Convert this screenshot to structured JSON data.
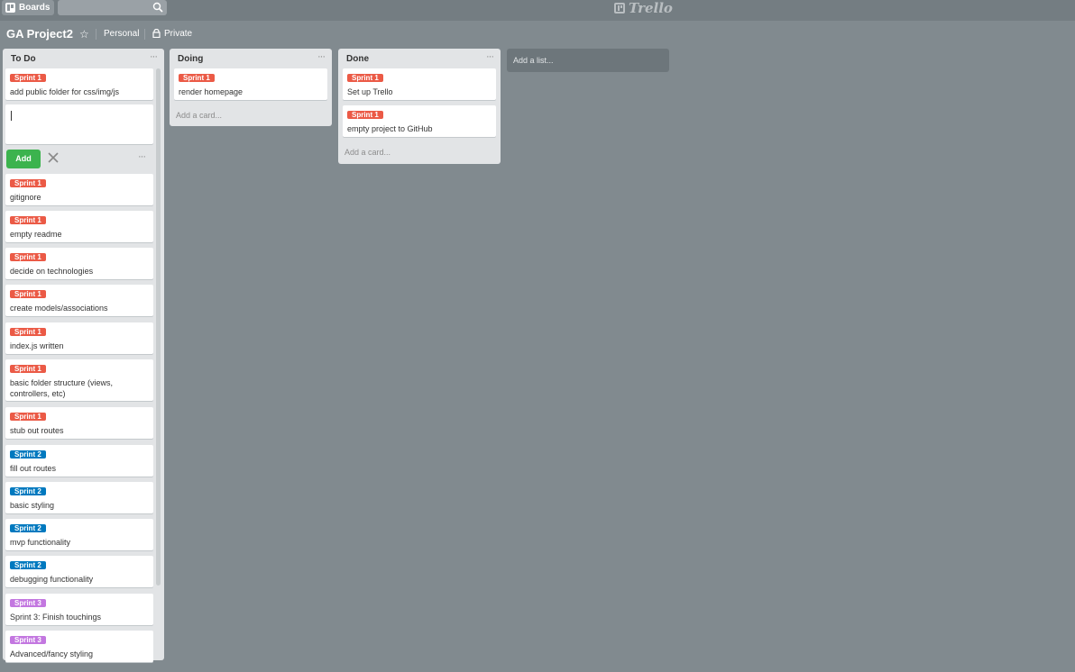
{
  "header": {
    "boards_label": "Boards",
    "search_placeholder": "",
    "logo_text": "Trello"
  },
  "board": {
    "title": "GA Project2",
    "team": "Personal",
    "privacy": "Private"
  },
  "lists": [
    {
      "title": "To Do",
      "cards_before_composer": [
        {
          "label": "Sprint 1",
          "label_color": "#eb5a46",
          "title": "add public folder for css/img/js"
        }
      ],
      "composer": {
        "value": "",
        "add_label": "Add"
      },
      "cards_after_composer": [
        {
          "label": "Sprint 1",
          "label_color": "#eb5a46",
          "title": "gitignore"
        },
        {
          "label": "Sprint 1",
          "label_color": "#eb5a46",
          "title": "empty readme"
        },
        {
          "label": "Sprint 1",
          "label_color": "#eb5a46",
          "title": "decide on technologies"
        },
        {
          "label": "Sprint 1",
          "label_color": "#eb5a46",
          "title": "create models/associations"
        },
        {
          "label": "Sprint 1",
          "label_color": "#eb5a46",
          "title": "index.js written"
        },
        {
          "label": "Sprint 1",
          "label_color": "#eb5a46",
          "title": "basic folder structure (views, controllers, etc)"
        },
        {
          "label": "Sprint 1",
          "label_color": "#eb5a46",
          "title": "stub out routes"
        },
        {
          "label": "Sprint 2",
          "label_color": "#0079bf",
          "title": "fill out routes"
        },
        {
          "label": "Sprint 2",
          "label_color": "#0079bf",
          "title": "basic styling"
        },
        {
          "label": "Sprint 2",
          "label_color": "#0079bf",
          "title": "mvp functionality"
        },
        {
          "label": "Sprint 2",
          "label_color": "#0079bf",
          "title": "debugging functionality"
        },
        {
          "label": "Sprint 3",
          "label_color": "#c377e0",
          "title": "Sprint 3: Finish touchings"
        },
        {
          "label": "Sprint 3",
          "label_color": "#c377e0",
          "title": "Advanced/fancy styling"
        }
      ]
    },
    {
      "title": "Doing",
      "cards": [
        {
          "label": "Sprint 1",
          "label_color": "#eb5a46",
          "title": "render homepage"
        }
      ],
      "add_card": "Add a card..."
    },
    {
      "title": "Done",
      "cards": [
        {
          "label": "Sprint 1",
          "label_color": "#eb5a46",
          "title": "Set up Trello"
        },
        {
          "label": "Sprint 1",
          "label_color": "#eb5a46",
          "title": "empty project to GitHub"
        }
      ],
      "add_card": "Add a card..."
    }
  ],
  "add_list": "Add a list..."
}
